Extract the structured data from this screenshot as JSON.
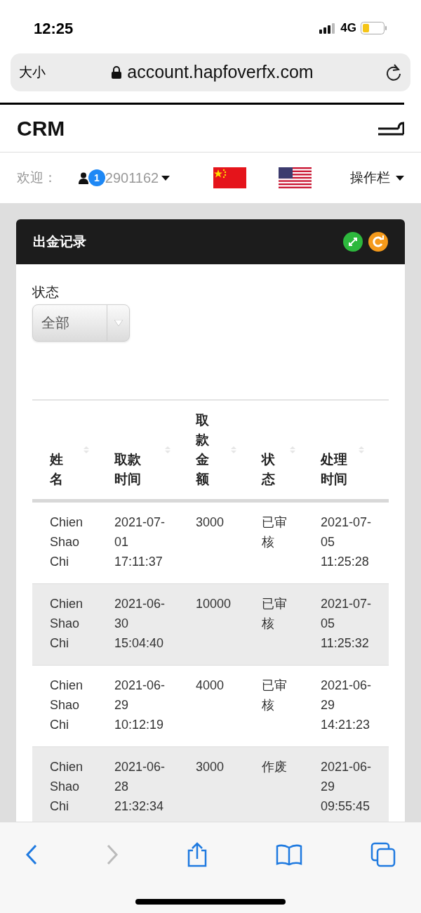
{
  "status_bar": {
    "time": "12:25",
    "network": "4G"
  },
  "browser": {
    "text_size": "大小",
    "url": "account.hapfoverfx.com"
  },
  "header": {
    "title": "CRM"
  },
  "user_bar": {
    "welcome": "欢迎：",
    "badge": "1",
    "account": "2901162",
    "menu": "操作栏"
  },
  "panel": {
    "title": "出金记录",
    "filter": {
      "label": "状态",
      "value": "全部"
    },
    "table": {
      "columns": [
        "姓名",
        "取款时间",
        "取款金额",
        "状态",
        "处理时间"
      ],
      "rows": [
        {
          "cells": [
            "Chien Shao Chi",
            "2021-07-01 17:11:37",
            "3000",
            "已审核",
            "2021-07-05 11:25:28"
          ]
        },
        {
          "cells": [
            "Chien Shao Chi",
            "2021-06-30 15:04:40",
            "10000",
            "已审核",
            "2021-07-05 11:25:32"
          ]
        },
        {
          "cells": [
            "Chien Shao Chi",
            "2021-06-29 10:12:19",
            "4000",
            "已审核",
            "2021-06-29 14:21:23"
          ]
        },
        {
          "cells": [
            "Chien Shao Chi",
            "2021-06-28 21:32:34",
            "3000",
            "作废",
            "2021-06-29 09:55:45"
          ]
        }
      ]
    }
  }
}
